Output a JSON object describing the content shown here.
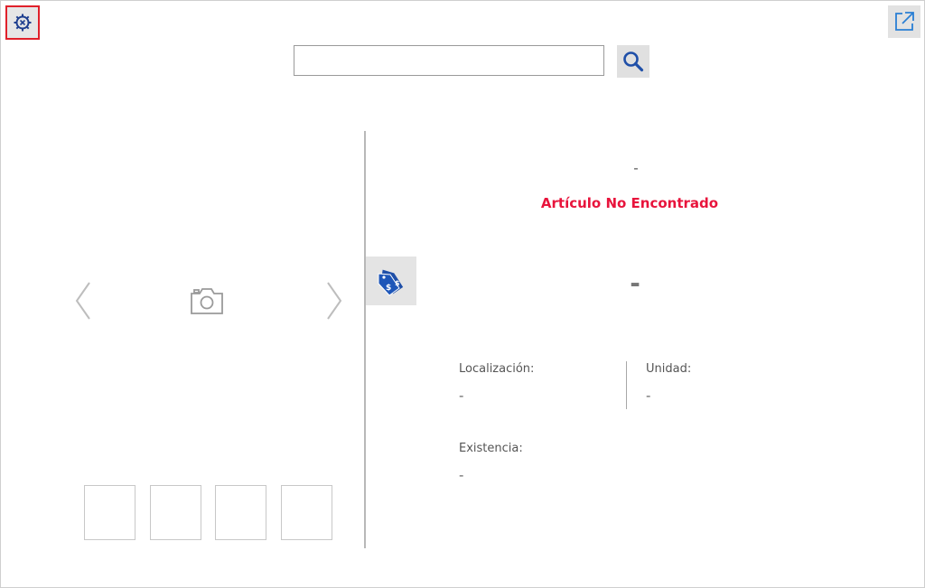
{
  "toolbar": {
    "settings_icon": "gear-icon",
    "export_icon": "external-link-icon"
  },
  "search": {
    "value": "",
    "placeholder": "",
    "button_icon": "magnifier-icon"
  },
  "gallery": {
    "prev_icon": "chevron-left-icon",
    "next_icon": "chevron-right-icon",
    "image_icon": "camera-icon",
    "thumbnail_count": 4
  },
  "article": {
    "description": "-",
    "status": "Artículo No Encontrado",
    "price": "-",
    "price_icon": "price-tag-icon"
  },
  "details": {
    "location_label": "Localización:",
    "location_value": "-",
    "unit_label": "Unidad:",
    "unit_value": "-",
    "stock_label": "Existencia:",
    "stock_value": "-"
  },
  "colors": {
    "status_red": "#e8143c",
    "icon_blue": "#1f4fa8",
    "highlight_red": "#e0202a"
  }
}
